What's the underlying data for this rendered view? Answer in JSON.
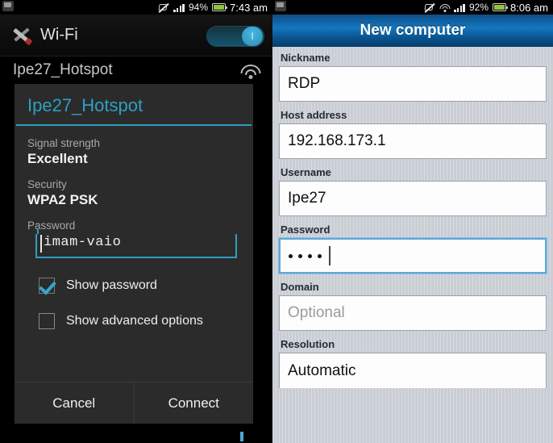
{
  "left": {
    "statusbar": {
      "notification_icon": "message-icon",
      "mute_icon": "mute-icon",
      "signal_icon": "signal-bars-icon",
      "battery_percent": "94%",
      "battery_icon": "battery-icon",
      "time": "7:43 am"
    },
    "header": {
      "icon": "wrench-settings-icon",
      "title": "Wi-Fi",
      "toggle_state_label": "I",
      "toggle_on": true
    },
    "network_row": {
      "name": "Ipe27_Hotspot",
      "icon": "wifi-signal-icon"
    },
    "dialog": {
      "title": "Ipe27_Hotspot",
      "fields": [
        {
          "label": "Signal strength",
          "value": "Excellent"
        },
        {
          "label": "Security",
          "value": "WPA2 PSK"
        }
      ],
      "password_label": "Password",
      "password_value": "imam-vaio",
      "checkboxes": [
        {
          "label": "Show password",
          "checked": true
        },
        {
          "label": "Show advanced options",
          "checked": false
        }
      ],
      "cancel_label": "Cancel",
      "connect_label": "Connect"
    },
    "colors": {
      "accent": "#2e9ec2",
      "dialog_bg": "#2b2b2b",
      "panel_bg": "#000000"
    }
  },
  "right": {
    "statusbar": {
      "notification_icon": "message-icon",
      "mute_icon": "mute-icon",
      "wifi_icon": "wifi-icon",
      "signal_icon": "signal-bars-icon",
      "battery_percent": "92%",
      "battery_icon": "battery-icon",
      "time": "8:06 am"
    },
    "header": {
      "title": "New computer"
    },
    "form": {
      "fields": [
        {
          "label": "Nickname",
          "value": "RDP",
          "placeholder": "",
          "focused": false,
          "masked": false
        },
        {
          "label": "Host address",
          "value": "192.168.173.1",
          "placeholder": "",
          "focused": false,
          "masked": false
        },
        {
          "label": "Username",
          "value": "Ipe27",
          "placeholder": "",
          "focused": false,
          "masked": false
        },
        {
          "label": "Password",
          "value": "····",
          "placeholder": "",
          "focused": true,
          "masked": true,
          "dot_count": 4
        },
        {
          "label": "Domain",
          "value": "",
          "placeholder": "Optional",
          "focused": false,
          "masked": false
        },
        {
          "label": "Resolution",
          "value": "Automatic",
          "placeholder": "",
          "focused": false,
          "masked": false
        }
      ]
    },
    "colors": {
      "header_blue": "#1477bf",
      "panel_bg": "#c9cdd4",
      "focus_border": "#5aa8dc"
    }
  }
}
